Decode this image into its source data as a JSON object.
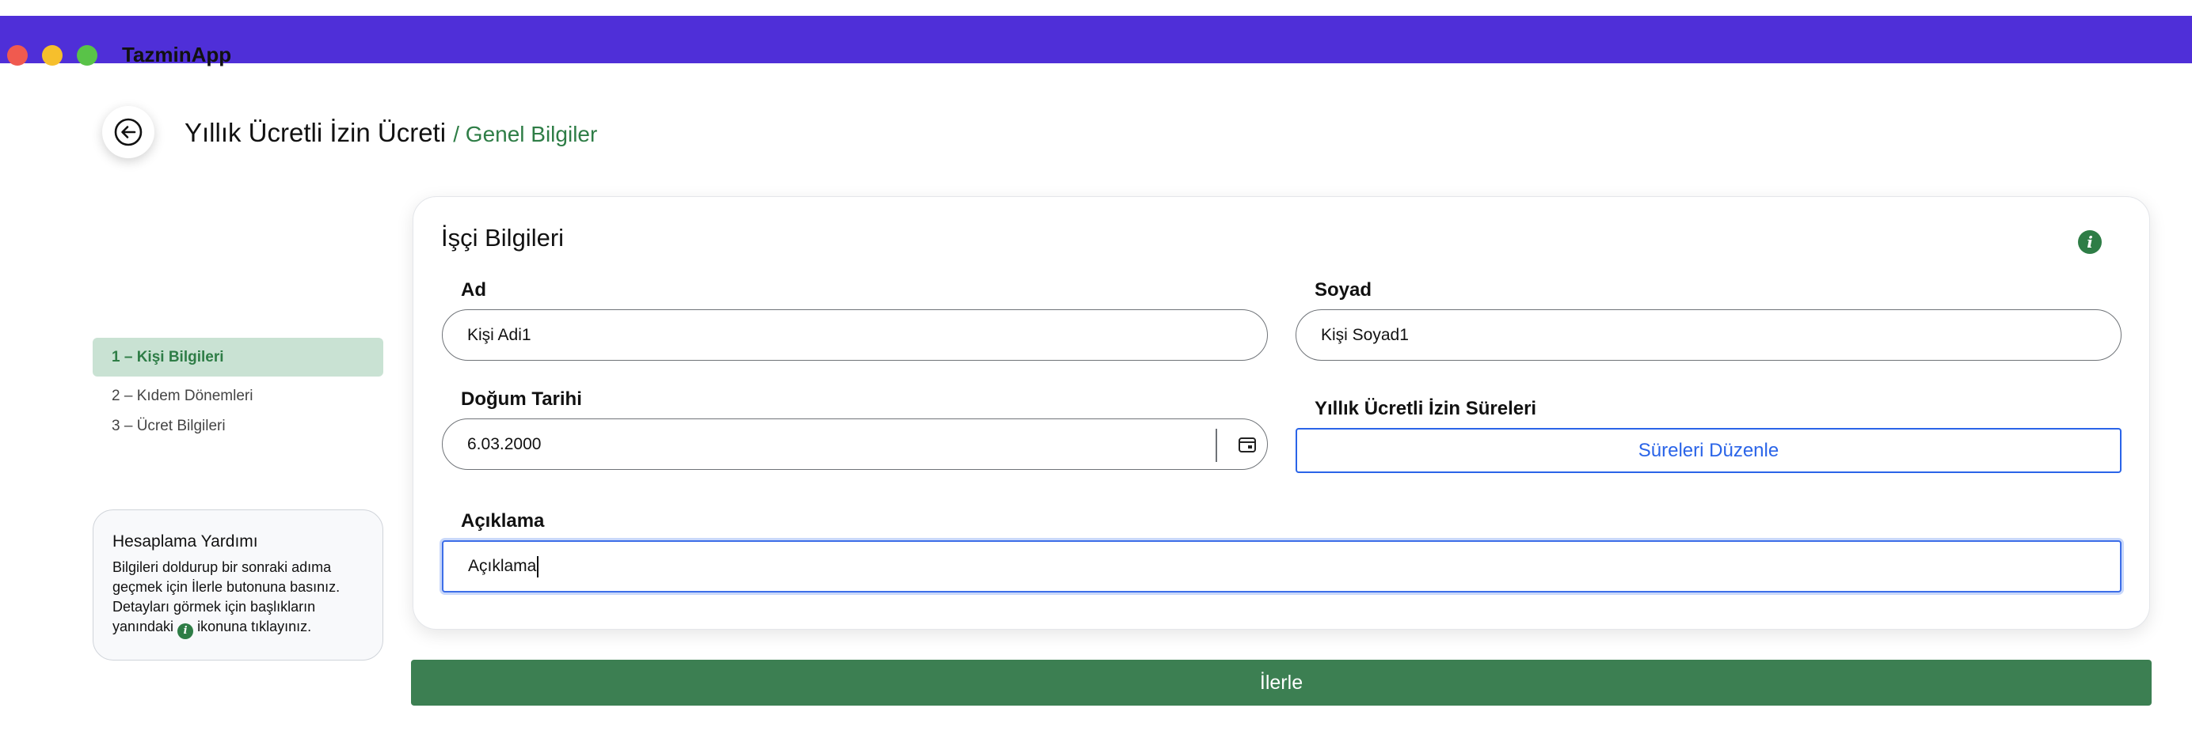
{
  "window": {
    "app_title": "TazminApp",
    "controls": [
      "close",
      "minimize",
      "zoom"
    ]
  },
  "header": {
    "title": "Yıllık Ücretli İzin Ücreti",
    "breadcrumb": "/ Genel Bilgiler",
    "back_icon": "arrow-left-circle-icon"
  },
  "steps": [
    {
      "label": "1 – Kişi Bilgileri",
      "active": true
    },
    {
      "label": "2 – Kıdem Dönemleri",
      "active": false
    },
    {
      "label": "3 – Ücret Bilgileri",
      "active": false
    }
  ],
  "help": {
    "title": "Hesaplama Yardımı",
    "text_line1": "Bilgileri doldurup bir sonraki adıma",
    "text_line2": "geçmek için İlerle butonuna basınız.",
    "text_line3": "Detayları görmek için başlıkların",
    "text_line4_before": "yanındaki",
    "text_line4_after": "ikonuna tıklayınız.",
    "info_glyph": "i"
  },
  "form": {
    "title": "İşçi Bilgileri",
    "info_glyph": "i",
    "ad": {
      "label": "Ad",
      "value": "Kişi Adi1"
    },
    "soyad": {
      "label": "Soyad",
      "value": "Kişi Soyad1"
    },
    "dogum_tarihi": {
      "label": "Doğum Tarihi",
      "value": "6.03.2000",
      "icon": "calendar-icon"
    },
    "izin_sureleri": {
      "label": "Yıllık Ücretli İzin Süreleri",
      "button_label": "Süreleri Düzenle"
    },
    "aciklama": {
      "label": "Açıklama",
      "value": "Açıklama"
    }
  },
  "next_button": {
    "label": "İlerle"
  },
  "colors": {
    "titlebar": "#4f2fd8",
    "accent_green": "#2e7d46",
    "button_green": "#3c7f52",
    "link_blue": "#2a64e8",
    "active_step_bg": "#c9e2d3"
  }
}
